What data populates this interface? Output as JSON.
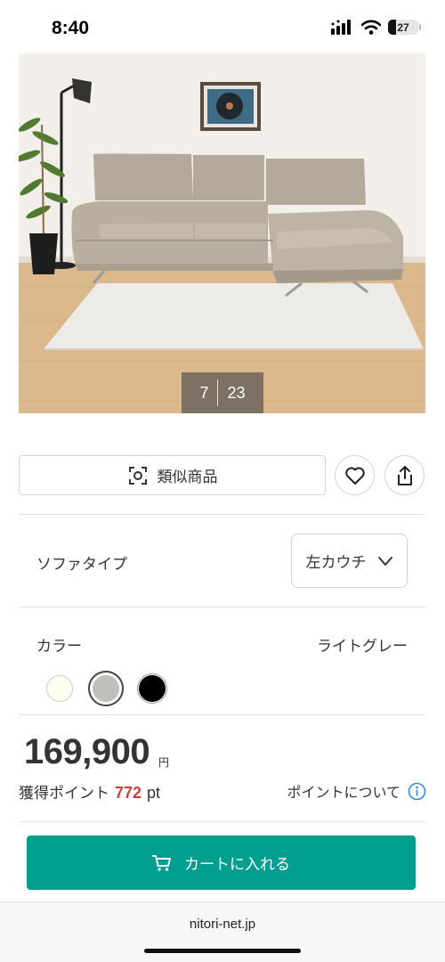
{
  "status_bar": {
    "time": "8:40",
    "battery": "27"
  },
  "gallery": {
    "current": "7",
    "total": "23"
  },
  "actions": {
    "similar_label": "類似商品"
  },
  "sofa_type": {
    "label": "ソファタイプ",
    "selected": "左カウチ"
  },
  "color": {
    "label": "カラー",
    "selected_name": "ライトグレー",
    "swatches": [
      "#fdfdf0",
      "#bfc0bc",
      "#000000"
    ]
  },
  "price": {
    "amount": "169,900",
    "currency": "円"
  },
  "points": {
    "label": "獲得ポイント",
    "value": "772",
    "unit": "pt",
    "about_label": "ポイントについて"
  },
  "cart": {
    "label": "カートに入れる"
  },
  "browser": {
    "url": "nitori-net.jp"
  },
  "colors": {
    "accent": "#009e8f",
    "points_red": "#c8433b",
    "info_blue": "#3b8ad8"
  }
}
